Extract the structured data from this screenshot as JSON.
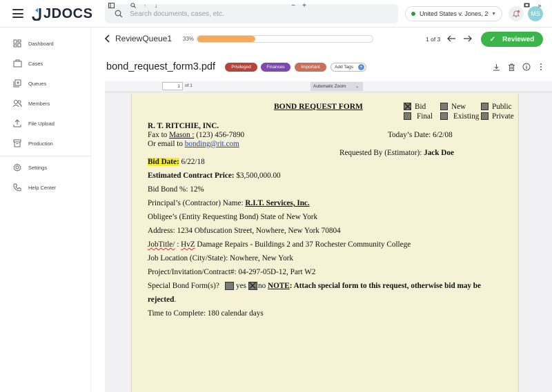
{
  "app": {
    "logo_text": "JDOCS",
    "search_placeholder": "Search documents, cases, etc.",
    "case_selector": "United States v. Jones, 20...",
    "user_initials": "MS"
  },
  "sidebar": {
    "items": [
      {
        "label": "Dashboard",
        "icon": "dashboard-icon"
      },
      {
        "label": "Cases",
        "icon": "briefcase-icon"
      },
      {
        "label": "Queues",
        "icon": "queue-icon"
      },
      {
        "label": "Members",
        "icon": "members-icon"
      },
      {
        "label": "File Upload",
        "icon": "upload-icon"
      },
      {
        "label": "Production",
        "icon": "archive-icon"
      },
      {
        "label": "Settings",
        "icon": "gear-icon"
      },
      {
        "label": "Help Center",
        "icon": "phone-icon"
      }
    ]
  },
  "review": {
    "queue_title": "ReviewQueue1",
    "progress_text": "33%",
    "progress_value": 0.33,
    "pagination": "1 of 3",
    "reviewed_label": "Reviewed"
  },
  "document": {
    "filename": "bond_request_form3.pdf",
    "tags": [
      {
        "label": "Privileged",
        "color": "#b5443c"
      },
      {
        "label": "Finances",
        "color": "#7e49b0"
      },
      {
        "label": "Important",
        "color": "#c8705a"
      }
    ],
    "add_tags_label": "Add Tags"
  },
  "viewer": {
    "page_number": "1",
    "page_total": "of 1",
    "zoom": "Automatic Zoom"
  },
  "pdf": {
    "form_title": "BOND REQUEST FORM",
    "checkbox_bid": "Bid",
    "checkbox_new": "New",
    "checkbox_public": "Public",
    "checkbox_final": "Final",
    "checkbox_existing": "Existing",
    "checkbox_private": "Private",
    "company": "R. T. RITCHIE, INC.",
    "fax_prefix": "Fax to",
    "fax_name": "Mason :",
    "fax_number": "(123) 456-7890",
    "email_prefix": "Or email to",
    "email": "bonding@rit.com",
    "todays_date_label": "Today’s Date:",
    "todays_date": "6/2/08",
    "requested_by_label": "Requested By (Estimator):",
    "requested_by": "Jack Doe",
    "bid_date_label": "Bid Date:",
    "bid_date": "6/22/18",
    "contract_price_label": "Estimated Contract Price:",
    "contract_price": "$3,500,000.00",
    "bid_bond_label": "Bid Bond %:",
    "bid_bond": "12%",
    "principal_label": "Principal’s (Contractor) Name:",
    "principal": "R.I.T. Services, Inc.",
    "obligee": "Obligee’s (Entity Requesting Bond) State of New York",
    "address": "Address: 1234 Obfuscation Street, Nowhere, New York 70804",
    "jobtitle_a": "JobTitle/",
    "jobtitle_b": ":",
    "jobtitle_c": "HvZ",
    "jobtitle_d": "Damage Repairs - Buildings 2 and 37 Rochester Community College",
    "job_location": "Job Location (City/State): Nowhere, New York",
    "project": "Project/Invitation/Contract#: 04-297-05D-12, Part W2",
    "special_label": "Special Bond Form(s)?",
    "special_yes": "yes",
    "special_no": "no",
    "note_label": "NOTE",
    "note_text": ": Attach special form to this request, otherwise bid may be",
    "note_text2": "rejected",
    "note_period": ".",
    "time_to_complete": "Time to Complete: 180 calendar days"
  },
  "colors": {
    "accent_green": "#3bb54a",
    "progress_orange": "#f2a960",
    "page_background": "#f5f2d5",
    "highlight": "#f3ee2c"
  }
}
